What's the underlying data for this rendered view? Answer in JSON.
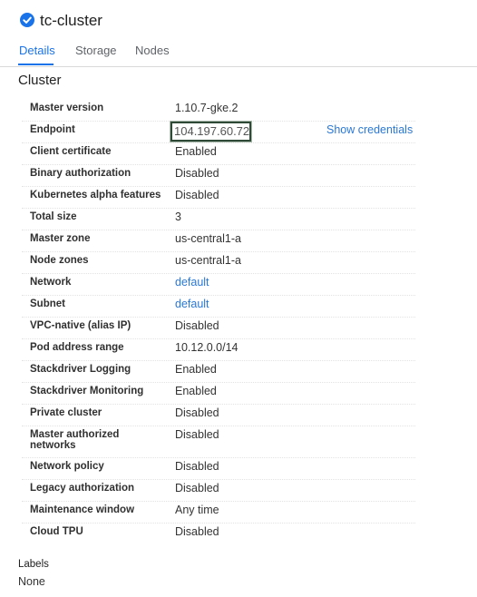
{
  "header": {
    "title": "tc-cluster"
  },
  "tabs": [
    {
      "label": "Details"
    },
    {
      "label": "Storage"
    },
    {
      "label": "Nodes"
    }
  ],
  "section": {
    "title": "Cluster"
  },
  "endpoint": {
    "value": "104.197.60.72",
    "action": "Show credentials"
  },
  "rows": [
    {
      "label": "Master version",
      "value": "1.10.7-gke.2"
    },
    {
      "label": "Endpoint",
      "value": "104.197.60.72"
    },
    {
      "label": "Client certificate",
      "value": "Enabled"
    },
    {
      "label": "Binary authorization",
      "value": "Disabled"
    },
    {
      "label": "Kubernetes alpha features",
      "value": "Disabled"
    },
    {
      "label": "Total size",
      "value": "3"
    },
    {
      "label": "Master zone",
      "value": "us-central1-a"
    },
    {
      "label": "Node zones",
      "value": "us-central1-a"
    },
    {
      "label": "Network",
      "value": "default"
    },
    {
      "label": "Subnet",
      "value": "default"
    },
    {
      "label": "VPC-native (alias IP)",
      "value": "Disabled"
    },
    {
      "label": "Pod address range",
      "value": "10.12.0.0/14"
    },
    {
      "label": "Stackdriver Logging",
      "value": "Enabled"
    },
    {
      "label": "Stackdriver Monitoring",
      "value": "Enabled"
    },
    {
      "label": "Private cluster",
      "value": "Disabled"
    },
    {
      "label": "Master authorized networks",
      "value": "Disabled"
    },
    {
      "label": "Network policy",
      "value": "Disabled"
    },
    {
      "label": "Legacy authorization",
      "value": "Disabled"
    },
    {
      "label": "Maintenance window",
      "value": "Any time"
    },
    {
      "label": "Cloud TPU",
      "value": "Disabled"
    }
  ],
  "labels": {
    "title": "Labels",
    "value": "None"
  },
  "colors": {
    "accent": "#1a73e8",
    "link": "#2a78d6",
    "endpoint_border": "#2f4a36"
  }
}
